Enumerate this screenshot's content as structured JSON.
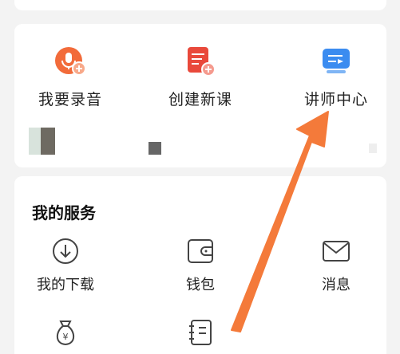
{
  "quick_actions": [
    {
      "label": "我要录音",
      "icon": "microphone-plus-icon",
      "color": "#f26b3a"
    },
    {
      "label": "创建新课",
      "icon": "document-plus-icon",
      "color": "#e9493b"
    },
    {
      "label": "讲师中心",
      "icon": "presentation-screen-icon",
      "color": "#3b8cf0"
    }
  ],
  "services": {
    "title": "我的服务",
    "items": [
      {
        "label": "我的下载",
        "icon": "download-circle-icon"
      },
      {
        "label": "钱包",
        "icon": "wallet-icon"
      },
      {
        "label": "消息",
        "icon": "envelope-icon"
      },
      {
        "label": "",
        "icon": "money-bag-icon"
      },
      {
        "label": "",
        "icon": "notebook-icon"
      }
    ]
  },
  "colors": {
    "accent_arrow": "#f47a3a",
    "page_background": "#f3f3f3",
    "card_background": "#ffffff"
  }
}
